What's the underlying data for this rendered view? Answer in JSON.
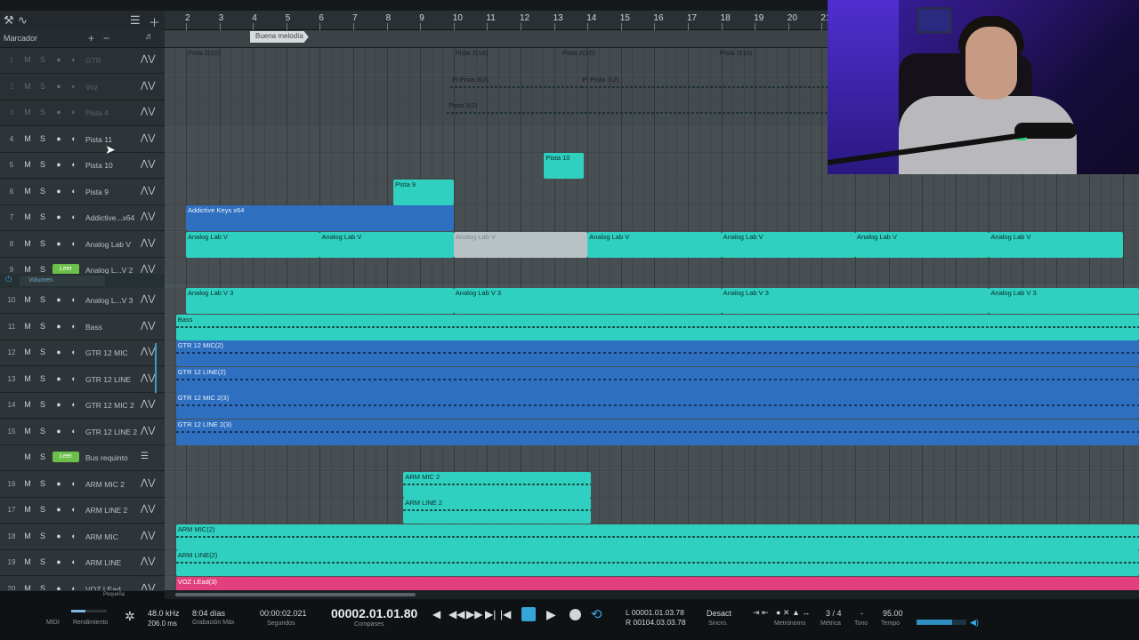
{
  "toolbar": {
    "marker_label": "Marcador"
  },
  "ruler": {
    "bars": [
      "2",
      "3",
      "4",
      "5",
      "6",
      "7",
      "8",
      "9",
      "10",
      "11",
      "12",
      "13",
      "14",
      "15",
      "16",
      "17",
      "18",
      "19",
      "20",
      "21"
    ]
  },
  "marker": {
    "label": "Buena melodía"
  },
  "tracks": [
    {
      "num": "1",
      "name": "GTR",
      "dim": true
    },
    {
      "num": "2",
      "name": "Voz",
      "dim": true
    },
    {
      "num": "3",
      "name": "Pista 4",
      "dim": true
    },
    {
      "num": "4",
      "name": "Pista 11"
    },
    {
      "num": "5",
      "name": "Pista 10"
    },
    {
      "num": "6",
      "name": "Pista 9"
    },
    {
      "num": "7",
      "name": "Addictive...x64"
    },
    {
      "num": "8",
      "name": "Analog Lab V"
    },
    {
      "num": "9",
      "name": "Analog L...V 2",
      "leer": true
    },
    {
      "num": "10",
      "name": "Analog L...V 3"
    },
    {
      "num": "11",
      "name": "Bass"
    },
    {
      "num": "12",
      "name": "GTR 12 MIC"
    },
    {
      "num": "13",
      "name": "GTR 12 LINE"
    },
    {
      "num": "14",
      "name": "GTR 12 MIC 2"
    },
    {
      "num": "15",
      "name": "GTR 12 LINE 2"
    },
    {
      "num": "",
      "name": "Bus requinto",
      "leer": true,
      "bus": true
    },
    {
      "num": "16",
      "name": "ARM MIC 2"
    },
    {
      "num": "17",
      "name": "ARM LINE 2"
    },
    {
      "num": "18",
      "name": "ARM MIC"
    },
    {
      "num": "19",
      "name": "ARM LINE"
    },
    {
      "num": "20",
      "name": "VOZ LEad"
    }
  ],
  "buttons": {
    "mute": "M",
    "solo": "S",
    "leer": "Leer",
    "volume_select": "Volumen"
  },
  "events": [
    {
      "lane": 0,
      "start": 2,
      "end": 10,
      "label": "Pista 2(10)",
      "style": "ghost"
    },
    {
      "lane": 0,
      "start": 10,
      "end": 13.2,
      "label": "Pista 2(10)",
      "style": "ghost"
    },
    {
      "lane": 0,
      "start": 13.2,
      "end": 17.9,
      "label": "Pista 2(10)",
      "style": "ghost"
    },
    {
      "lane": 0,
      "start": 17.9,
      "end": 21.3,
      "label": "Pista 2(10)",
      "style": "ghost"
    },
    {
      "lane": 1,
      "start": 9.9,
      "end": 13.8,
      "label": "Pi Pista 3(2)",
      "style": "ghost",
      "wave": true
    },
    {
      "lane": 1,
      "start": 13.8,
      "end": 21.3,
      "label": "Pi Pista 3(2)",
      "style": "ghost",
      "wave": true
    },
    {
      "lane": 2,
      "start": 9.8,
      "end": 21.3,
      "label": "Pista 3(2)",
      "style": "ghost",
      "wave": true
    },
    {
      "lane": 4,
      "start": 12.7,
      "end": 13.9,
      "label": "Pista 10",
      "style": "teal"
    },
    {
      "lane": 5,
      "start": 8.2,
      "end": 10,
      "label": "Pista 9",
      "style": "teal"
    },
    {
      "lane": 6,
      "start": 2,
      "end": 10,
      "label": "Addictive Keys x64",
      "style": "blue"
    },
    {
      "lane": 7,
      "start": 2,
      "end": 6,
      "label": "Analog Lab V",
      "style": "teal"
    },
    {
      "lane": 7,
      "start": 6,
      "end": 10,
      "label": "Analog Lab V",
      "style": "teal"
    },
    {
      "lane": 7,
      "start": 10,
      "end": 14,
      "label": "Analog Lab V",
      "style": "grey"
    },
    {
      "lane": 7,
      "start": 14,
      "end": 18,
      "label": "Analog Lab V",
      "style": "teal"
    },
    {
      "lane": 7,
      "start": 18,
      "end": 22,
      "label": "Analog Lab V",
      "style": "teal"
    },
    {
      "lane": 7,
      "start": 22,
      "end": 26,
      "label": "Analog Lab V",
      "style": "teal"
    },
    {
      "lane": 7,
      "start": 26,
      "end": 30,
      "label": "Analog Lab V",
      "style": "teal"
    },
    {
      "lane": 9,
      "start": 2,
      "end": 10,
      "label": "Analog Lab V 3",
      "style": "teal"
    },
    {
      "lane": 9,
      "start": 10,
      "end": 18,
      "label": "Analog Lab V 3",
      "style": "teal"
    },
    {
      "lane": 9,
      "start": 18,
      "end": 26,
      "label": "Analog Lab V 3",
      "style": "teal"
    },
    {
      "lane": 9,
      "start": 26,
      "end": 34,
      "label": "Analog Lab V 3",
      "style": "teal"
    },
    {
      "lane": 10,
      "start": 1.7,
      "end": 40,
      "label": "Bass",
      "style": "teal",
      "wave": true
    },
    {
      "lane": 11,
      "start": 1.7,
      "end": 40,
      "label": "GTR 12 MIC(2)",
      "style": "blue",
      "wave": true
    },
    {
      "lane": 12,
      "start": 1.7,
      "end": 40,
      "label": "GTR 12 LINE(2)",
      "style": "blue",
      "wave": true
    },
    {
      "lane": 13,
      "start": 1.7,
      "end": 40,
      "label": "GTR 12 MIC 2(3)",
      "style": "blue",
      "wave": true
    },
    {
      "lane": 14,
      "start": 1.7,
      "end": 40,
      "label": "GTR 12 LINE 2(3)",
      "style": "blue",
      "wave": true
    },
    {
      "lane": 16,
      "start": 8.5,
      "end": 14.1,
      "label": "ARM MIC 2",
      "style": "teal",
      "wave": true
    },
    {
      "lane": 17,
      "start": 8.5,
      "end": 14.1,
      "label": "ARM LINE 2",
      "style": "teal",
      "wave": true
    },
    {
      "lane": 18,
      "start": 1.7,
      "end": 40,
      "label": "ARM MIC(2)",
      "style": "teal",
      "wave": true
    },
    {
      "lane": 19,
      "start": 1.7,
      "end": 40,
      "label": "ARM LINE(2)",
      "style": "teal",
      "wave": true
    },
    {
      "lane": 20,
      "start": 1.7,
      "end": 40,
      "label": "VOZ LEad(3)",
      "style": "pink"
    }
  ],
  "transport": {
    "midi": "MIDI",
    "performance": "Rendimiento",
    "cpu_level": 0.4,
    "sample_rate": "48.0 kHz",
    "latency": "206.0 ms",
    "rec_days": "8:04 días",
    "rec_max": "Grabación Máx",
    "seconds_value": "00:00:02.021",
    "seconds_label": "Segundos",
    "bars_value": "00002.01.01.80",
    "bars_label": "Compases",
    "loop_l": "L  00001.01.03.78",
    "loop_r": "R  00104.03.03.78",
    "sync_value": "Desact",
    "sync_label": "Sincro.",
    "metronome_label": "Metrónomo",
    "signature_value": "3 / 4",
    "signature_label": "Métrica",
    "key_value": "-",
    "key_label": "Tono",
    "tempo_value": "95.00",
    "tempo_label": "Tempo",
    "volume_level": 0.72
  },
  "size_toggle": "Pequeña"
}
